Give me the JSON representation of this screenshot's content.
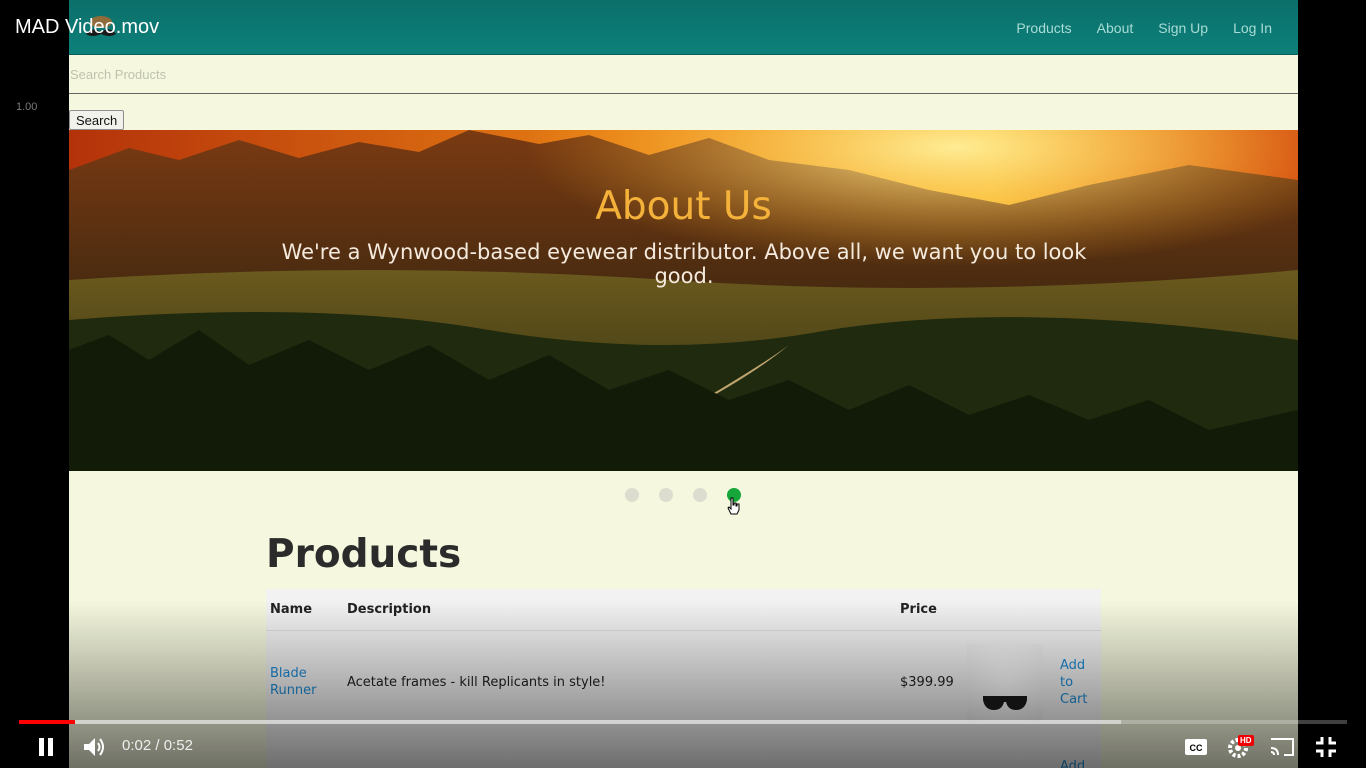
{
  "player": {
    "title": "MAD Video.mov",
    "speed_label": "1.00",
    "time_current": "0:02",
    "time_separator": " / ",
    "time_total": "0:52",
    "progress_played": 0.042,
    "progress_buffered": 0.83,
    "hd_badge": "HD",
    "accent_color": "#ff0000"
  },
  "site": {
    "nav": {
      "items": [
        {
          "label": "Products"
        },
        {
          "label": "About"
        },
        {
          "label": "Sign Up"
        },
        {
          "label": "Log In"
        }
      ]
    },
    "search": {
      "placeholder": "Search Products",
      "button_label": "Search"
    },
    "hero": {
      "title": "About Us",
      "subtitle": "We're a Wynwood-based eyewear distributor. Above all, we want you to look good.",
      "slides": 4,
      "active_slide": 4,
      "active_dot_color": "#17a63a"
    },
    "products": {
      "heading": "Products",
      "columns": [
        "Name",
        "Description",
        "Price"
      ],
      "rows": [
        {
          "name": "Blade Runner",
          "description": "Acetate frames - kill Replicants in style!",
          "price": "$399.99",
          "action": "Add to Cart"
        }
      ],
      "partial_action": "Add"
    }
  }
}
